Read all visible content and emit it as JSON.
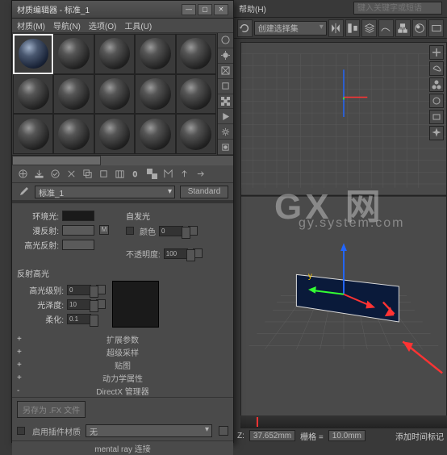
{
  "top_menu": {
    "help": "帮助(H)",
    "search_placeholder": "键入关键字或短语"
  },
  "main_toolbar": {
    "selection_set": "创建选择集"
  },
  "watermark": {
    "main": "GX 网",
    "sub": "gy.system.com"
  },
  "status": {
    "z_label": "Z:",
    "z_value": "37.652mm",
    "grid_label": "栅格 =",
    "grid_value": "10.0mm",
    "add_key": "添加时间标记"
  },
  "mat_editor": {
    "title": "材质编辑器 - 标准_1",
    "menu": {
      "material": "材质(M)",
      "navigate": "导航(N)",
      "options": "选项(O)",
      "utilities": "工具(U)"
    },
    "name": "标准_1",
    "type": "Standard",
    "params": {
      "ambient": "环境光:",
      "diffuse": "漫反射:",
      "specular": "高光反射:",
      "self_illum": "自发光",
      "color_cb": "颜色",
      "opacity": "不透明度:",
      "opacity_val": "100",
      "spec_highlights": "反射高光",
      "spec_level": "高光级别:",
      "spec_level_val": "0",
      "glossiness": "光泽度:",
      "glossiness_val": "10",
      "soften": "柔化:",
      "soften_val": "0.1",
      "diffuse_m": "M",
      "color_val": "0"
    },
    "rollouts": {
      "ext_params": "扩展参数",
      "super_sample": "超级采样",
      "maps": "贴图",
      "dynamics": "动力学属性",
      "directx": "DirectX 管理器"
    },
    "save_fx": "另存为 .FX 文件",
    "enable_plugin": "启用插件材质",
    "plugin_none": "无",
    "mr_connection": "mental ray 连接"
  }
}
